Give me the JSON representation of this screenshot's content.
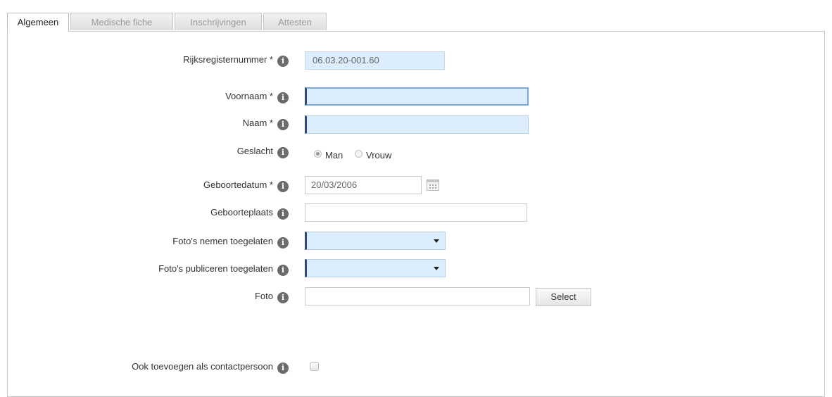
{
  "tabs": [
    {
      "label": "Algemeen",
      "active": true
    },
    {
      "label": "Medische fiche",
      "active": false
    },
    {
      "label": "Inschrijvingen",
      "active": false
    },
    {
      "label": "Attesten",
      "active": false
    }
  ],
  "form": {
    "rijksregister": {
      "label": "Rijksregisternummer *",
      "value": "06.03.20-001.60"
    },
    "voornaam": {
      "label": "Voornaam *",
      "value": ""
    },
    "naam": {
      "label": "Naam *",
      "value": ""
    },
    "geslacht": {
      "label": "Geslacht",
      "options": [
        "Man",
        "Vrouw"
      ],
      "selected": "Man"
    },
    "geboortedatum": {
      "label": "Geboortedatum *",
      "value": "20/03/2006"
    },
    "geboorteplaats": {
      "label": "Geboorteplaats",
      "value": ""
    },
    "fotos_nemen": {
      "label": "Foto's nemen toegelaten",
      "value": ""
    },
    "fotos_publiceren": {
      "label": "Foto's publiceren toegelaten",
      "value": ""
    },
    "foto": {
      "label": "Foto",
      "value": "",
      "button": "Select"
    },
    "contactpersoon": {
      "label": "Ook toevoegen als contactpersoon",
      "checked": false
    }
  },
  "info_glyph": "i",
  "colors": {
    "required_bg": "#dceefe",
    "required_marker": "#2e4a7d"
  }
}
